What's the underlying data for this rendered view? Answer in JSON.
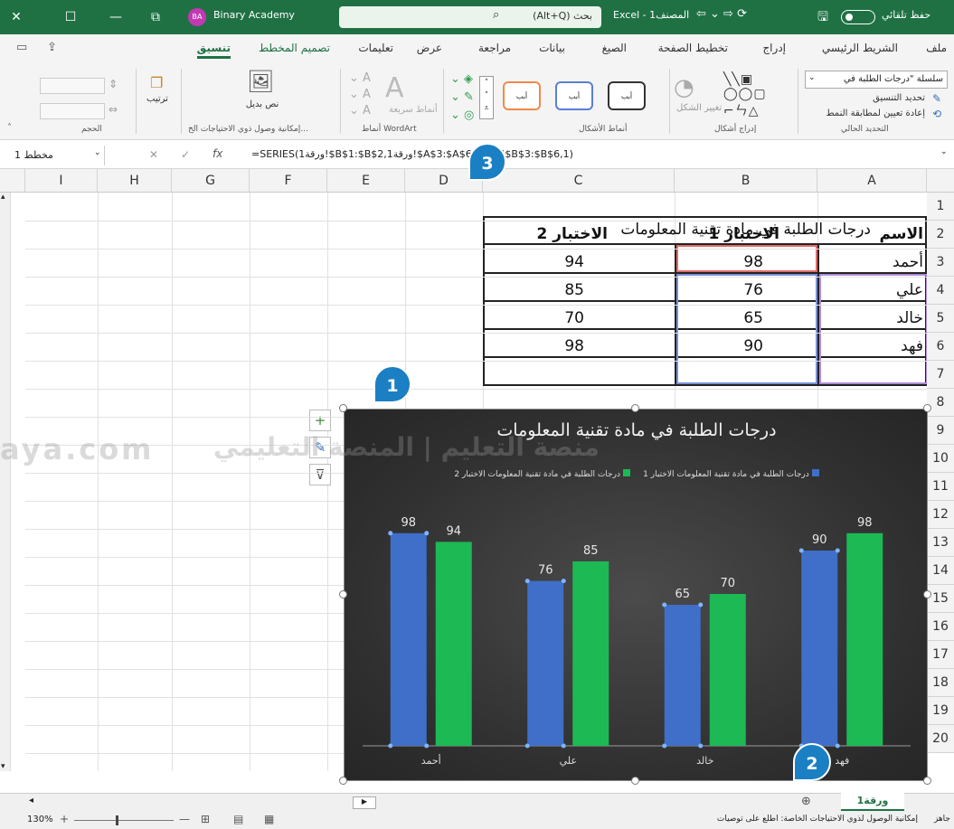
{
  "titlebar": {
    "autosave_label": "حفظ تلقائي",
    "file_title": "Excel - المصنف1",
    "search_placeholder": "بحث (Alt+Q)",
    "account_name": "Binary Academy",
    "account_initials": "BA",
    "close_glyph": "✕",
    "maximize_glyph": "☐",
    "minimize_glyph": "—",
    "restore_glyph": "⧉"
  },
  "menu": {
    "items": [
      "ملف",
      "الشريط الرئيسي",
      "إدراج",
      "تخطيط الصفحة",
      "الصيغ",
      "بيانات",
      "مراجعة",
      "عرض",
      "تعليمات",
      "تصميم المخطط",
      "تنسيق"
    ]
  },
  "ribbon": {
    "current_selection_value": "سلسلة \"درجات الطلبة في",
    "format_selection": "تحديد التنسيق",
    "reset_to_match": "إعادة تعيين لمطابقة النمط",
    "group_current_selection": "التحديد الحالي",
    "change_shape": "تغيير الشكل",
    "group_insert_shapes": "إدراج أشكال",
    "group_shape_styles": "أنماط الأشكال",
    "shape_style_label": "أبب",
    "quick_styles": "أنماط سريعة",
    "group_wordart": "أنماط WordArt",
    "alt_text": "نص بديل",
    "group_accessibility": "إمكانية وصول ذوي الاحتياجات الخ...",
    "arrange": "ترتيب",
    "group_size": "الحجم"
  },
  "formula_bar": {
    "name_box": "مخطط 1",
    "formula": "=SERIES(ورقة1!$B$1:$B$2,ورقة1!$A$3:$A$6,ورقة1!$B$3:$B$6,1)",
    "fx": "fx"
  },
  "sheet": {
    "columns": [
      "A",
      "B",
      "C",
      "D",
      "E",
      "F",
      "G",
      "H",
      "I"
    ],
    "rows": [
      "1",
      "2",
      "3",
      "4",
      "5",
      "6",
      "7",
      "8",
      "9",
      "10",
      "11",
      "12",
      "13",
      "14",
      "15",
      "16",
      "17",
      "18",
      "19",
      "20"
    ],
    "table_title": "درجات الطلبة في مادة تقنية المعلومات",
    "headers": [
      "الاسم",
      "الاختبار 1",
      "الاختبار 2"
    ],
    "data_rows": [
      [
        "أحمد",
        "98",
        "94"
      ],
      [
        "علي",
        "76",
        "85"
      ],
      [
        "خالد",
        "65",
        "70"
      ],
      [
        "فهد",
        "90",
        "98"
      ]
    ]
  },
  "chart_data": {
    "type": "bar",
    "title": "درجات الطلبة في مادة تقنية المعلومات",
    "categories": [
      "أحمد",
      "علي",
      "خالد",
      "فهد"
    ],
    "series": [
      {
        "name": "درجات الطلبة في مادة تقنية المعلومات الاختبار 1",
        "values": [
          98,
          76,
          65,
          90
        ],
        "color": "#3f6fc8"
      },
      {
        "name": "درجات الطلبة في مادة تقنية المعلومات الاختبار 2",
        "values": [
          94,
          85,
          70,
          98
        ],
        "color": "#1db954"
      }
    ],
    "ylim": [
      0,
      105
    ],
    "legend_position": "top",
    "grid": false,
    "data_labels": true
  },
  "callouts": [
    "1",
    "2",
    "3"
  ],
  "sheet_tabs": {
    "active": "ورقة1",
    "add_glyph": "⊕"
  },
  "status": {
    "ready": "جاهز",
    "accessibility": "إمكانية الوصول لذوي الاحتياجات الخاصة: اطلع على توصيات",
    "zoom": "130%"
  },
  "watermark": {
    "site": "aya.com",
    "platform": "منصة التعليم | المنصة التعليمي"
  }
}
